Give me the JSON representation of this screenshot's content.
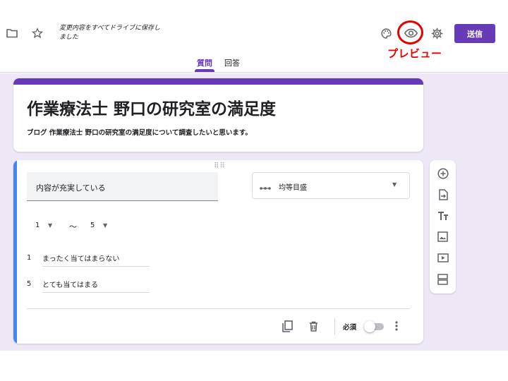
{
  "header": {
    "save_status": "変更内容をすべてドライブに保存しました",
    "send_label": "送信",
    "preview_annotation": "プレビュー",
    "tabs": [
      {
        "label": "質問",
        "active": true
      },
      {
        "label": "回答",
        "active": false
      }
    ],
    "icons": [
      "folder-icon",
      "star-icon",
      "palette-icon",
      "eye-icon",
      "gear-icon"
    ]
  },
  "form": {
    "title": "作業療法士 野口の研究室の満足度",
    "description": "ブログ 作業療法士 野口の研究室の満足度について調査したいと思います。"
  },
  "question": {
    "text": "内容が充実している",
    "type_label": "均等目盛",
    "range_min": "1",
    "range_tilde": "〜",
    "range_max": "5",
    "labels": [
      {
        "num": "1",
        "text": "まったく当てはまらない"
      },
      {
        "num": "5",
        "text": "とても当てはまる"
      }
    ],
    "required_label": "必須",
    "required": false
  },
  "side_toolbar": [
    "add-circle-icon",
    "import-icon",
    "text-tt-icon",
    "image-icon",
    "video-icon",
    "section-icon"
  ],
  "colors": {
    "accent": "#673ab7",
    "background": "#ede7f6",
    "question_bar": "#4285f4",
    "annotation": "#e60000"
  }
}
